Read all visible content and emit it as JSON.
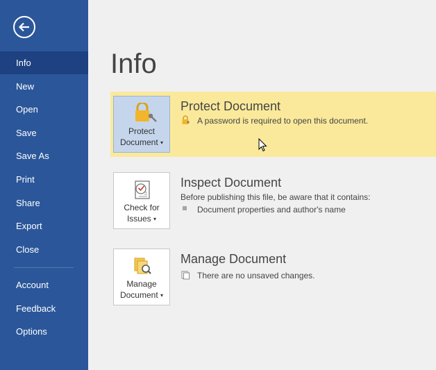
{
  "sidebar": {
    "items": [
      {
        "label": "Info"
      },
      {
        "label": "New"
      },
      {
        "label": "Open"
      },
      {
        "label": "Save"
      },
      {
        "label": "Save As"
      },
      {
        "label": "Print"
      },
      {
        "label": "Share"
      },
      {
        "label": "Export"
      },
      {
        "label": "Close"
      },
      {
        "label": "Account"
      },
      {
        "label": "Feedback"
      },
      {
        "label": "Options"
      }
    ]
  },
  "main": {
    "title": "Info",
    "protect": {
      "tile_label_1": "Protect",
      "tile_label_2": "Document",
      "title": "Protect Document",
      "line": "A password is required to open this document."
    },
    "inspect": {
      "tile_label_1": "Check for",
      "tile_label_2": "Issues",
      "title": "Inspect Document",
      "line1": "Before publishing this file, be aware that it contains:",
      "line2": "Document properties and author's name"
    },
    "manage": {
      "tile_label_1": "Manage",
      "tile_label_2": "Document",
      "title": "Manage Document",
      "line": "There are no unsaved changes."
    }
  },
  "colors": {
    "sidebar": "#2b579a",
    "sidebar_active": "#1e4281",
    "highlight": "#fbe99b",
    "selected_tile": "#c5d6ec"
  }
}
